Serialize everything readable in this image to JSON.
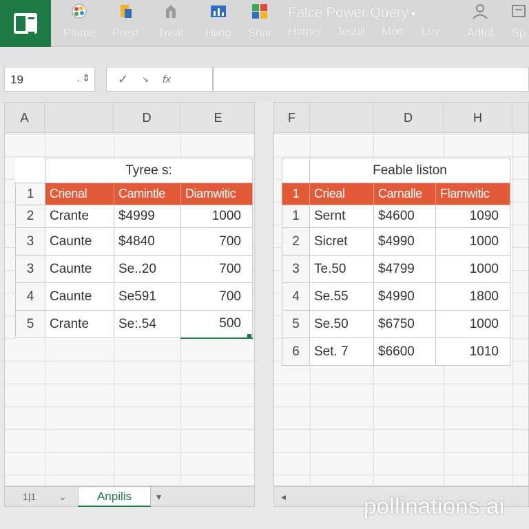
{
  "ribbon": {
    "items": [
      {
        "label": "Plame",
        "icon": "palette-icon"
      },
      {
        "label": "Prest",
        "icon": "paste-icon"
      },
      {
        "label": "Treat",
        "icon": "format-icon"
      },
      {
        "label": "Hiing",
        "icon": "chart-icon"
      },
      {
        "label": "Shar",
        "icon": "share-icon"
      }
    ],
    "title": "Falce Power Query",
    "tabs": [
      "Homer",
      "Jesult",
      "Moit",
      "Loy"
    ],
    "right_items": [
      {
        "label": "Adtol",
        "icon": "user-icon"
      },
      {
        "label": "Sp",
        "icon": "settings-icon"
      }
    ]
  },
  "formula_bar": {
    "name_box": "19",
    "name_box_extra": ".",
    "fx_symbol": "fx"
  },
  "left_sheet": {
    "columns": [
      "A",
      "D",
      "E"
    ],
    "table_title": "Tyree s:",
    "headers": [
      "1",
      "Crienal",
      "Camintle",
      "Diamwitic"
    ],
    "rows": [
      {
        "rn": "2",
        "name": "Crante",
        "amount": "$4999",
        "value": "1000"
      },
      {
        "rn": "3",
        "name": "Caunte",
        "amount": "$4840",
        "value": "700"
      },
      {
        "rn": "3",
        "name": "Caunte",
        "amount": "Se..20",
        "value": "700"
      },
      {
        "rn": "4",
        "name": "Caunte",
        "amount": "Se591",
        "value": "700"
      },
      {
        "rn": "5",
        "name": "Crante",
        "amount": "Se:.54",
        "value": "500"
      }
    ]
  },
  "right_sheet": {
    "columns": [
      "F",
      "D",
      "H"
    ],
    "table_title": "Feable liston",
    "headers": [
      "1",
      "Crieal",
      "Carnalle",
      "Flamwitic"
    ],
    "rows": [
      {
        "rn": "1",
        "name": "Sernt",
        "amount": "$4600",
        "value": "1090"
      },
      {
        "rn": "2",
        "name": "Sicret",
        "amount": "$4990",
        "value": "1000"
      },
      {
        "rn": "3",
        "name": "Te.50",
        "amount": "$4799",
        "value": "1000"
      },
      {
        "rn": "4",
        "name": "Se.55",
        "amount": "$4990",
        "value": "1800"
      },
      {
        "rn": "5",
        "name": "Se.50",
        "amount": "$6750",
        "value": "1000"
      },
      {
        "rn": "6",
        "name": "Set. 7",
        "amount": "$6600",
        "value": "1010"
      }
    ]
  },
  "sheet_tabs": {
    "nav_left": "1|1",
    "active": "Anpilis"
  },
  "watermark": "pollinations.ai",
  "colors": {
    "excel_green": "#1d7a45",
    "header_orange": "#e35a38"
  }
}
